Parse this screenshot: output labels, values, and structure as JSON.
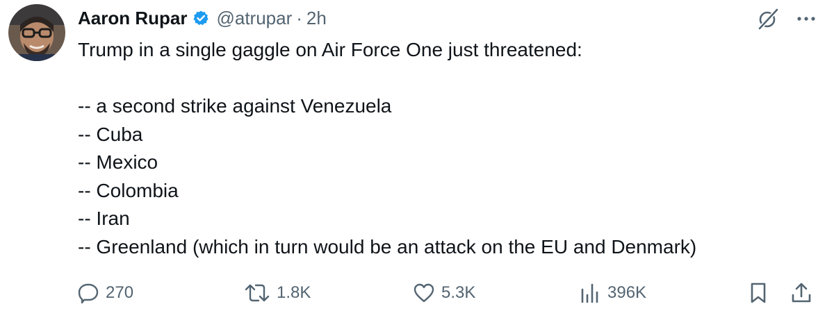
{
  "author": {
    "name": "Aaron Rupar",
    "handle": "@atrupar",
    "separator": "·",
    "time": "2h"
  },
  "tweet": {
    "lines": [
      "Trump in a single gaggle on Air Force One just threatened:",
      "",
      "-- a second strike against Venezuela",
      "-- Cuba",
      "-- Mexico",
      "-- Colombia",
      "-- Iran",
      "-- Greenland (which in turn would be an attack on the EU and Denmark)"
    ]
  },
  "actions": {
    "replies": "270",
    "retweets": "1.8K",
    "likes": "5.3K",
    "views": "396K"
  },
  "icons": {
    "verified": "verified-badge-icon",
    "grok": "grok-icon",
    "more": "more-icon",
    "reply": "reply-icon",
    "retweet": "retweet-icon",
    "like": "heart-icon",
    "views": "views-chart-icon",
    "bookmark": "bookmark-icon",
    "share": "share-icon"
  },
  "colors": {
    "verified": "#1d9bf0",
    "text": "#0f1419",
    "secondary": "#536471"
  }
}
